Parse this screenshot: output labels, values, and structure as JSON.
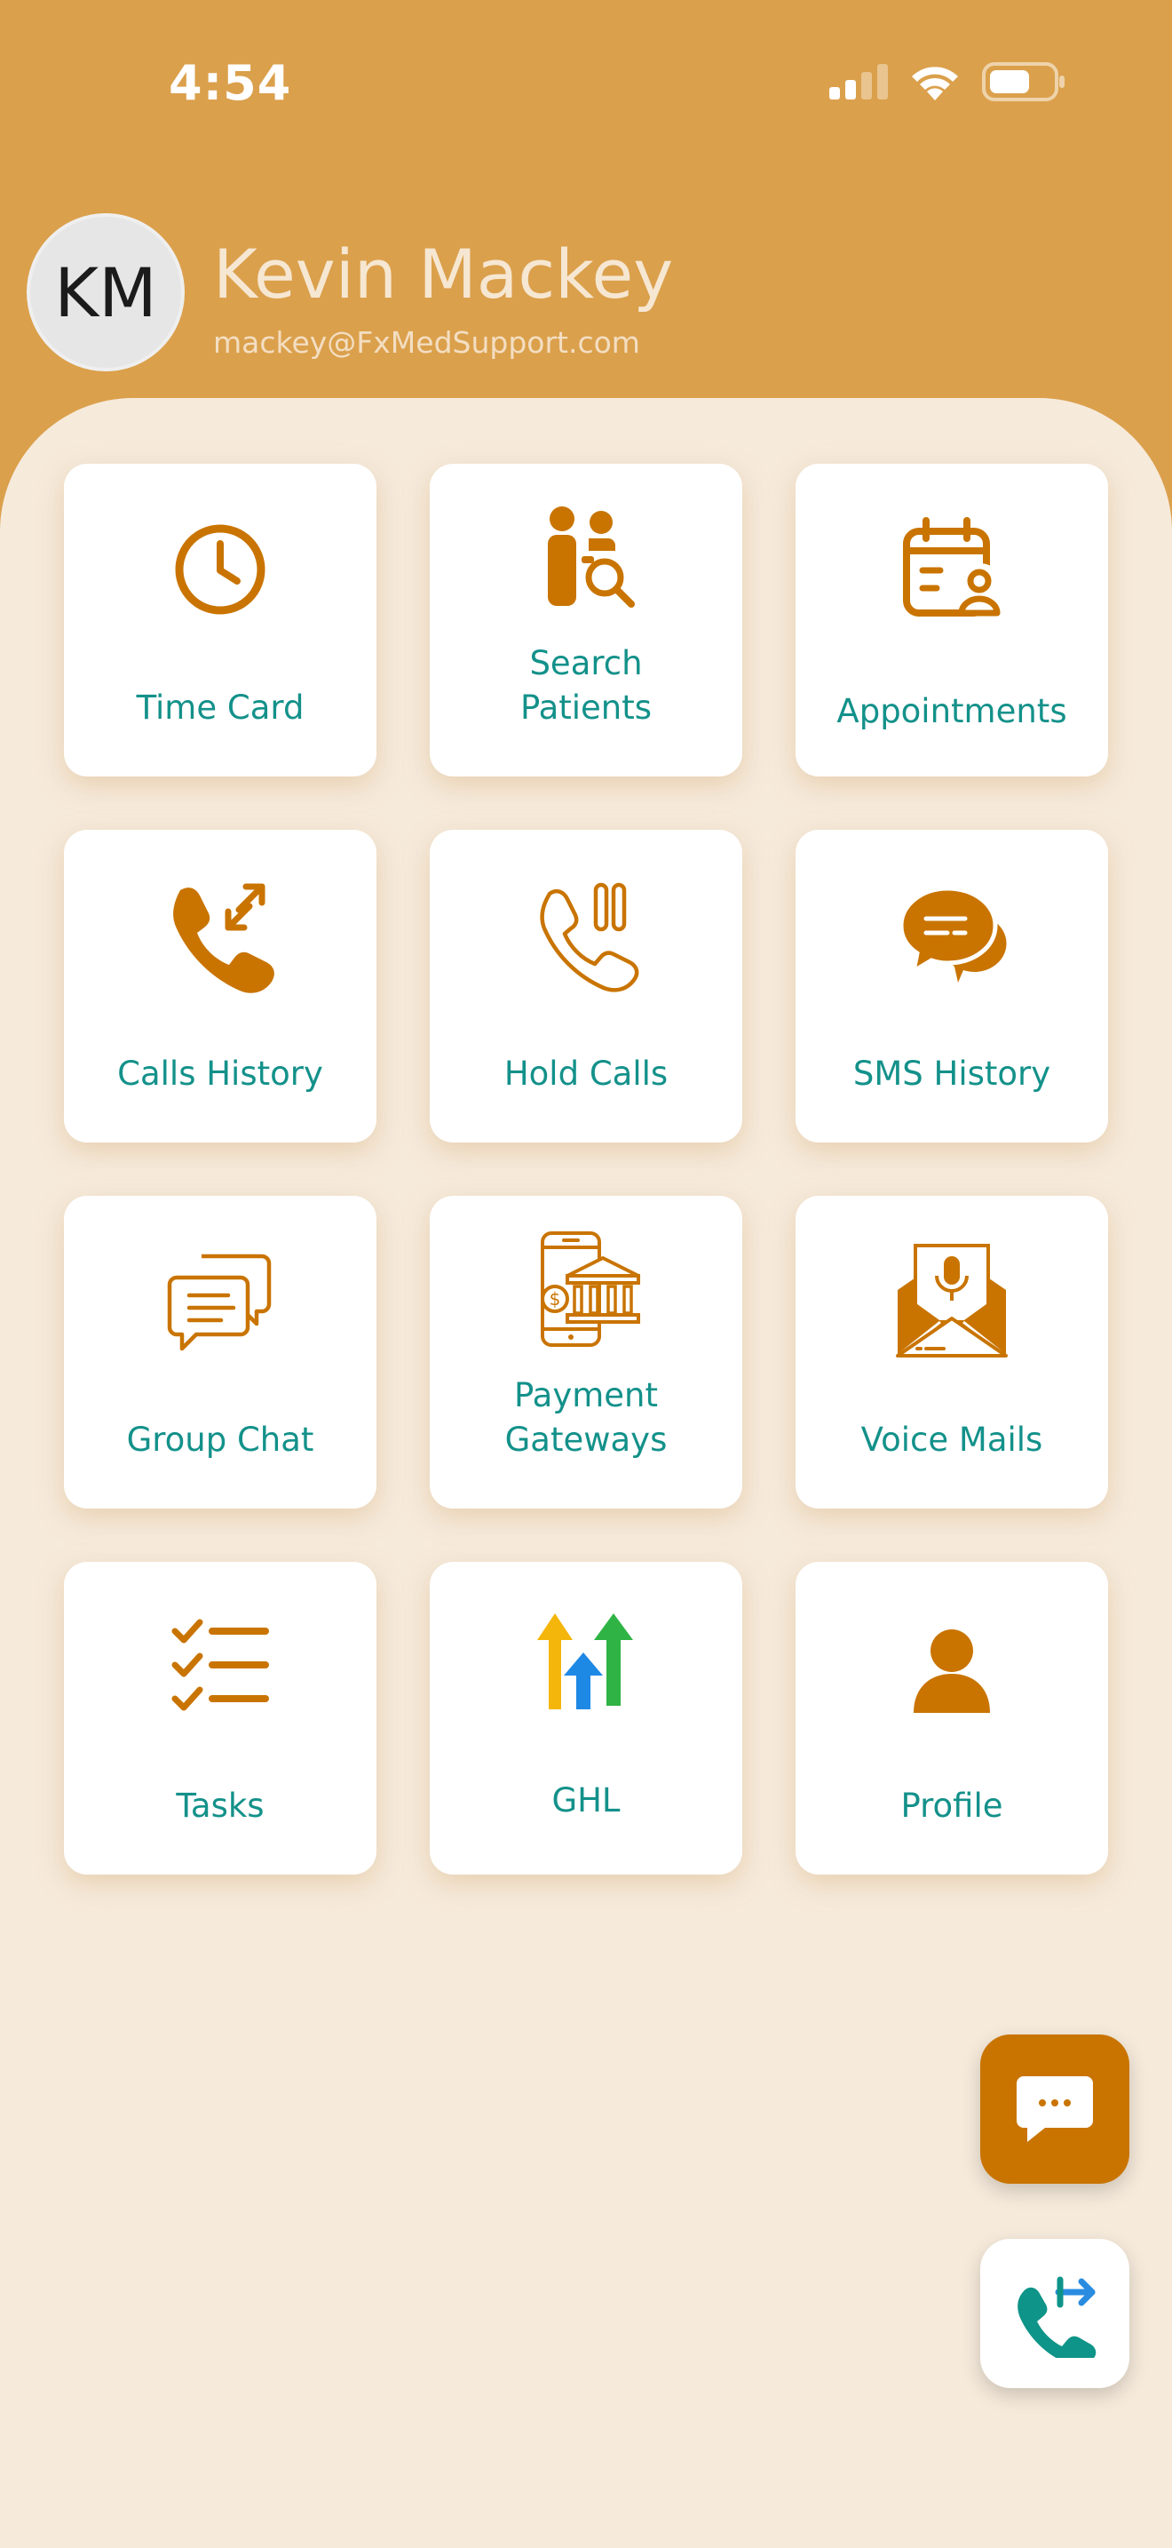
{
  "status_bar": {
    "time": "4:54"
  },
  "user": {
    "initials": "KM",
    "name": "Kevin Mackey",
    "email": "mackey@FxMedSupport.com"
  },
  "colors": {
    "header_bg": "#DBA04C",
    "content_bg": "#F6EADB",
    "icon_orange": "#C97400",
    "label_teal": "#13918A"
  },
  "tiles": [
    {
      "label": "Time Card",
      "icon": "clock-icon"
    },
    {
      "label": "Search\nPatients",
      "icon": "search-patients-icon"
    },
    {
      "label": "Appointments",
      "icon": "calendar-user-icon"
    },
    {
      "label": "Calls History",
      "icon": "phone-transfer-icon"
    },
    {
      "label": "Hold Calls",
      "icon": "phone-pause-icon"
    },
    {
      "label": "SMS History",
      "icon": "chat-bubbles-icon"
    },
    {
      "label": "Group Chat",
      "icon": "group-chat-icon"
    },
    {
      "label": "Payment\nGateways",
      "icon": "payment-bank-icon"
    },
    {
      "label": "Voice Mails",
      "icon": "voicemail-envelope-icon"
    },
    {
      "label": "Tasks",
      "icon": "checklist-icon"
    },
    {
      "label": "GHL",
      "icon": "ghl-arrows-icon"
    },
    {
      "label": "Profile",
      "icon": "person-icon"
    }
  ],
  "fabs": {
    "chat": "chat-dots-icon",
    "call": "call-transfer-icon"
  }
}
